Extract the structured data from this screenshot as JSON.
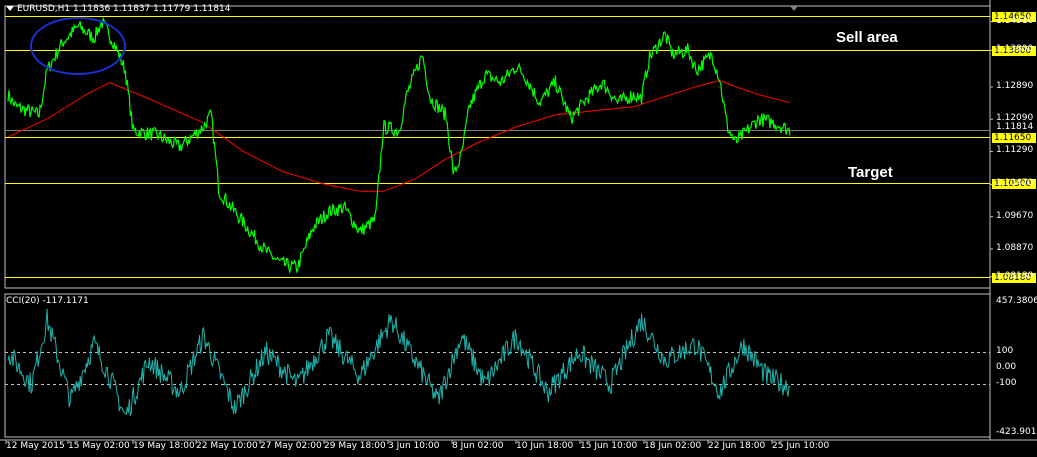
{
  "header": {
    "symbol_line": "EURUSD,H1  1.11836 1.11837 1.11779 1.11814",
    "cci_line": "CCI(20) -117.1171"
  },
  "annotations": {
    "sell_area": "Sell area",
    "target": "Target"
  },
  "colors": {
    "price": "#00ff00",
    "ma": "#ff0000",
    "levels": "#ffff00",
    "cci": "#20b2aa",
    "ellipse": "#1a2fd0"
  },
  "chart_data": [
    {
      "type": "line",
      "title": "EURUSD,H1",
      "ohlc": {
        "open": 1.11836,
        "high": 1.11837,
        "low": 1.11779,
        "close": 1.11814
      },
      "ylim": [
        1.079,
        1.149
      ],
      "price_ticks": [
        "1.14510",
        "1.13800",
        "1.12890",
        "1.12090",
        "1.11290",
        "1.10470",
        "1.09670",
        "1.08870",
        "1.08180"
      ],
      "current_price": "1.11814",
      "level_lines": [
        {
          "value": 1.1465,
          "label": "1.14650"
        },
        {
          "value": 1.138,
          "label": "1.13800"
        },
        {
          "value": 1.1165,
          "label": "1.11650"
        },
        {
          "value": 1.105,
          "label": "1.10500"
        },
        {
          "value": 1.0818,
          "label": "1.08180"
        }
      ],
      "x_labels": [
        "12 May 2015",
        "15 May 02:00",
        "19 May 18:00",
        "22 May 10:00",
        "27 May 02:00",
        "29 May 18:00",
        "3 Jun 10:00",
        "8 Jun 02:00",
        "10 Jun 18:00",
        "15 Jun 10:00",
        "18 Jun 02:00",
        "22 Jun 18:00",
        "25 Jun 10:00"
      ],
      "series": [
        {
          "key": "price",
          "anchors": [
            [
              0,
              1.127
            ],
            [
              0.01,
              1.124
            ],
            [
              0.04,
              1.122
            ],
            [
              0.05,
              1.133
            ],
            [
              0.07,
              1.14
            ],
            [
              0.09,
              1.144
            ],
            [
              0.11,
              1.141
            ],
            [
              0.12,
              1.145
            ],
            [
              0.135,
              1.14
            ],
            [
              0.15,
              1.133
            ],
            [
              0.16,
              1.118
            ],
            [
              0.19,
              1.117
            ],
            [
              0.22,
              1.114
            ],
            [
              0.25,
              1.119
            ],
            [
              0.26,
              1.122
            ],
            [
              0.27,
              1.103
            ],
            [
              0.29,
              1.098
            ],
            [
              0.31,
              1.093
            ],
            [
              0.33,
              1.088
            ],
            [
              0.35,
              1.085
            ],
            [
              0.37,
              1.084
            ],
            [
              0.39,
              1.094
            ],
            [
              0.41,
              1.098
            ],
            [
              0.43,
              1.099
            ],
            [
              0.45,
              1.093
            ],
            [
              0.47,
              1.096
            ],
            [
              0.48,
              1.119
            ],
            [
              0.5,
              1.118
            ],
            [
              0.51,
              1.127
            ],
            [
              0.53,
              1.137
            ],
            [
              0.54,
              1.126
            ],
            [
              0.56,
              1.122
            ],
            [
              0.57,
              1.107
            ],
            [
              0.58,
              1.112
            ],
            [
              0.59,
              1.124
            ],
            [
              0.61,
              1.132
            ],
            [
              0.63,
              1.13
            ],
            [
              0.65,
              1.134
            ],
            [
              0.66,
              1.132
            ],
            [
              0.68,
              1.125
            ],
            [
              0.7,
              1.13
            ],
            [
              0.72,
              1.121
            ],
            [
              0.74,
              1.126
            ],
            [
              0.76,
              1.13
            ],
            [
              0.78,
              1.125
            ],
            [
              0.8,
              1.127
            ],
            [
              0.81,
              1.126
            ],
            [
              0.82,
              1.136
            ],
            [
              0.84,
              1.142
            ],
            [
              0.85,
              1.137
            ],
            [
              0.87,
              1.138
            ],
            [
              0.88,
              1.133
            ],
            [
              0.9,
              1.137
            ],
            [
              0.91,
              1.131
            ],
            [
              0.92,
              1.119
            ],
            [
              0.93,
              1.115
            ],
            [
              0.94,
              1.117
            ],
            [
              0.96,
              1.121
            ],
            [
              0.98,
              1.12
            ],
            [
              1.0,
              1.1181
            ]
          ]
        },
        {
          "key": "ma",
          "anchors": [
            [
              0,
              1.1165
            ],
            [
              0.05,
              1.121
            ],
            [
              0.1,
              1.127
            ],
            [
              0.13,
              1.13
            ],
            [
              0.18,
              1.126
            ],
            [
              0.25,
              1.12
            ],
            [
              0.3,
              1.113
            ],
            [
              0.35,
              1.108
            ],
            [
              0.4,
              1.105
            ],
            [
              0.45,
              1.103
            ],
            [
              0.48,
              1.103
            ],
            [
              0.52,
              1.106
            ],
            [
              0.56,
              1.111
            ],
            [
              0.6,
              1.115
            ],
            [
              0.65,
              1.119
            ],
            [
              0.7,
              1.122
            ],
            [
              0.75,
              1.123
            ],
            [
              0.8,
              1.124
            ],
            [
              0.84,
              1.1265
            ],
            [
              0.88,
              1.129
            ],
            [
              0.91,
              1.1305
            ],
            [
              0.93,
              1.129
            ],
            [
              0.96,
              1.127
            ],
            [
              1.0,
              1.125
            ]
          ]
        }
      ]
    },
    {
      "type": "line",
      "title": "CCI(20)",
      "current_value": -117.1171,
      "ylim": [
        -423.901,
        457.3806
      ],
      "tick_labels": [
        "457.3806",
        "100",
        "0.00",
        "-100",
        "-423.901"
      ],
      "dashed_levels": [
        100,
        -100
      ],
      "series": [
        {
          "key": "cci",
          "anchors": [
            [
              0,
              100
            ],
            [
              0.03,
              -100
            ],
            [
              0.05,
              300
            ],
            [
              0.08,
              -200
            ],
            [
              0.11,
              150
            ],
            [
              0.13,
              -50
            ],
            [
              0.15,
              -300
            ],
            [
              0.18,
              50
            ],
            [
              0.22,
              -150
            ],
            [
              0.25,
              200
            ],
            [
              0.29,
              -250
            ],
            [
              0.33,
              100
            ],
            [
              0.37,
              -100
            ],
            [
              0.41,
              200
            ],
            [
              0.45,
              -50
            ],
            [
              0.49,
              300
            ],
            [
              0.52,
              50
            ],
            [
              0.55,
              -200
            ],
            [
              0.58,
              200
            ],
            [
              0.61,
              -100
            ],
            [
              0.65,
              200
            ],
            [
              0.69,
              -150
            ],
            [
              0.73,
              100
            ],
            [
              0.77,
              -100
            ],
            [
              0.81,
              300
            ],
            [
              0.84,
              50
            ],
            [
              0.88,
              150
            ],
            [
              0.91,
              -150
            ],
            [
              0.94,
              150
            ],
            [
              0.97,
              -50
            ],
            [
              1.0,
              -117
            ]
          ]
        }
      ]
    }
  ]
}
